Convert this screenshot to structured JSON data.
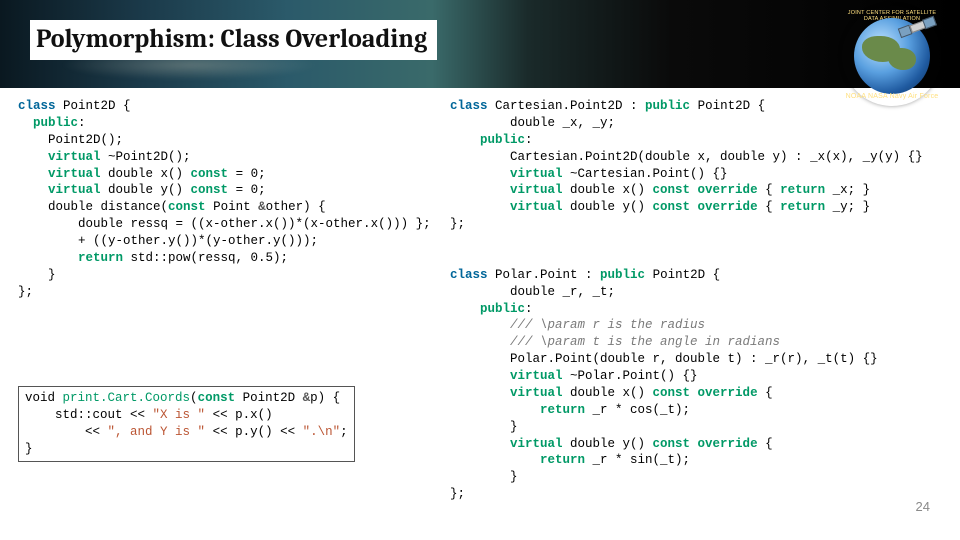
{
  "slide": {
    "title": "Polymorphism: Class Overloading",
    "page_number": "24",
    "logo": {
      "top_text": "JOINT CENTER FOR SATELLITE DATA ASSIMILATION",
      "bottom_text": "NOAA  NASA  Navy  Air Force"
    }
  },
  "code": {
    "left_block": {
      "l1a": "class",
      "l1b": " Point2D {",
      "l2a": "public",
      "l2b": ":",
      "l3": "Point2D();",
      "l4a": "virtual",
      "l4b": " ~Point2D();",
      "l5a": "virtual",
      "l5b": " double x() ",
      "l5c": "const",
      "l5d": " = 0;",
      "l6a": "virtual",
      "l6b": " double y() ",
      "l6c": "const",
      "l6d": " = 0;",
      "l7a": "double distance(",
      "l7b": "const",
      "l7c": " Point ",
      "l7d": "&",
      "l7e": "other) {",
      "l8": "double ressq = ((x-other.x())*(x-other.x())) };",
      "l9": "+ ((y-other.y())*(y-other.y()));",
      "l10a": "return",
      "l10b": " std::pow(ressq, 0.5);",
      "l11": "}",
      "l12": "};"
    },
    "print_block": {
      "p1a": "void ",
      "p1b": "print.Cart.Coords",
      "p1c": "(",
      "p1d": "const",
      "p1e": " Point2D ",
      "p1f": "&",
      "p1g": "p) {",
      "p2a": "std::cout << ",
      "p2b": "\"X is \"",
      "p2c": " << p.x()",
      "p3a": "<< ",
      "p3b": "\", and Y is \"",
      "p3c": " << p.y() << ",
      "p3d": "\".\\n\"",
      "p3e": ";",
      "p4": "}"
    },
    "right_block": {
      "r1a": "class",
      "r1b": " Cartesian.Point2D : ",
      "r1c": "public",
      "r1d": " Point2D {",
      "r2": "double _x, _y;",
      "r3a": "public",
      "r3b": ":",
      "r4": "Cartesian.Point2D(double x, double y) : _x(x), _y(y) {}",
      "r5a": "virtual",
      "r5b": " ~Cartesian.Point() {}",
      "r6a": "virtual",
      "r6b": " double x() ",
      "r6c": "const override",
      "r6d": " { ",
      "r6e": "return",
      "r6f": " _x; }",
      "r7a": "virtual",
      "r7b": " double y() ",
      "r7c": "const override",
      "r7d": " { ",
      "r7e": "return",
      "r7f": " _y; }",
      "r8": "};",
      "s1a": "class",
      "s1b": " Polar.Point : ",
      "s1c": "public",
      "s1d": " Point2D {",
      "s2": "double _r, _t;",
      "s3a": "public",
      "s3b": ":",
      "s4": "/// \\param r is the radius",
      "s5": "/// \\param t is the angle in radians",
      "s6": "Polar.Point(double r, double t) : _r(r), _t(t) {}",
      "s7a": "virtual",
      "s7b": " ~Polar.Point() {}",
      "s8a": "virtual",
      "s8b": " double x() ",
      "s8c": "const override",
      "s8d": " {",
      "s9a": "return",
      "s9b": " _r * cos(_t);",
      "s10": "}",
      "s11a": "virtual",
      "s11b": " double y() ",
      "s11c": "const override",
      "s11d": " {",
      "s12a": "return",
      "s12b": " _r * sin(_t);",
      "s13": "}",
      "s14": "};"
    }
  }
}
